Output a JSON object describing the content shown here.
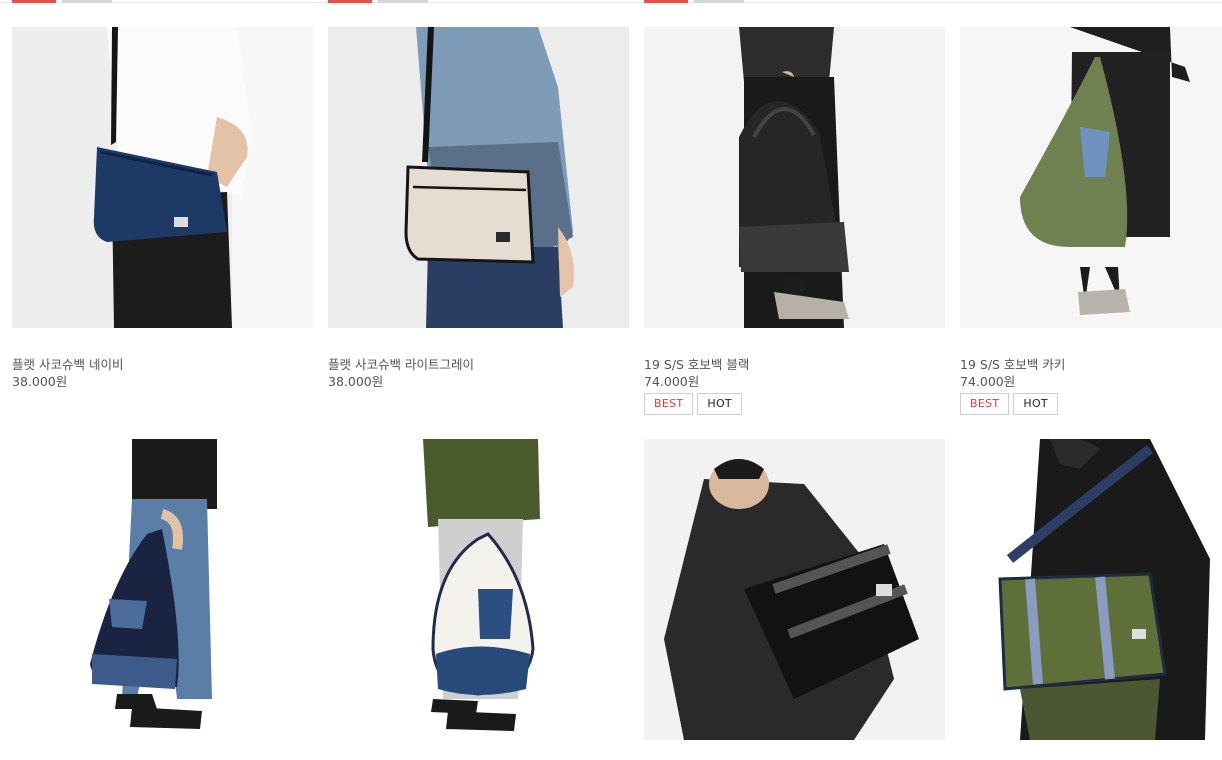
{
  "colors": {
    "accent": "#e03a3a",
    "text": "#555555",
    "badge_border": "#cfcfcf"
  },
  "products": [
    {
      "title": "플랫 사코슈백 네이비",
      "price": "38.000원",
      "badges": [],
      "image_icon": "product-photo-navy-sacoche"
    },
    {
      "title": "플랫 사코슈백 라이트그레이",
      "price": "38.000원",
      "badges": [],
      "image_icon": "product-photo-lightgray-sacoche"
    },
    {
      "title": "19 S/S 호보백 블랙",
      "price": "74.000원",
      "badges": [
        "BEST",
        "HOT"
      ],
      "image_icon": "product-photo-black-hobo"
    },
    {
      "title": "19 S/S 호보백 카키",
      "price": "74.000원",
      "badges": [
        "BEST",
        "HOT"
      ],
      "image_icon": "product-photo-khaki-hobo"
    },
    {
      "image_icon": "product-photo-navy-denim-hobo"
    },
    {
      "image_icon": "product-photo-white-denim-hobo"
    },
    {
      "image_icon": "product-photo-black-messenger"
    },
    {
      "image_icon": "product-photo-khaki-messenger"
    }
  ]
}
